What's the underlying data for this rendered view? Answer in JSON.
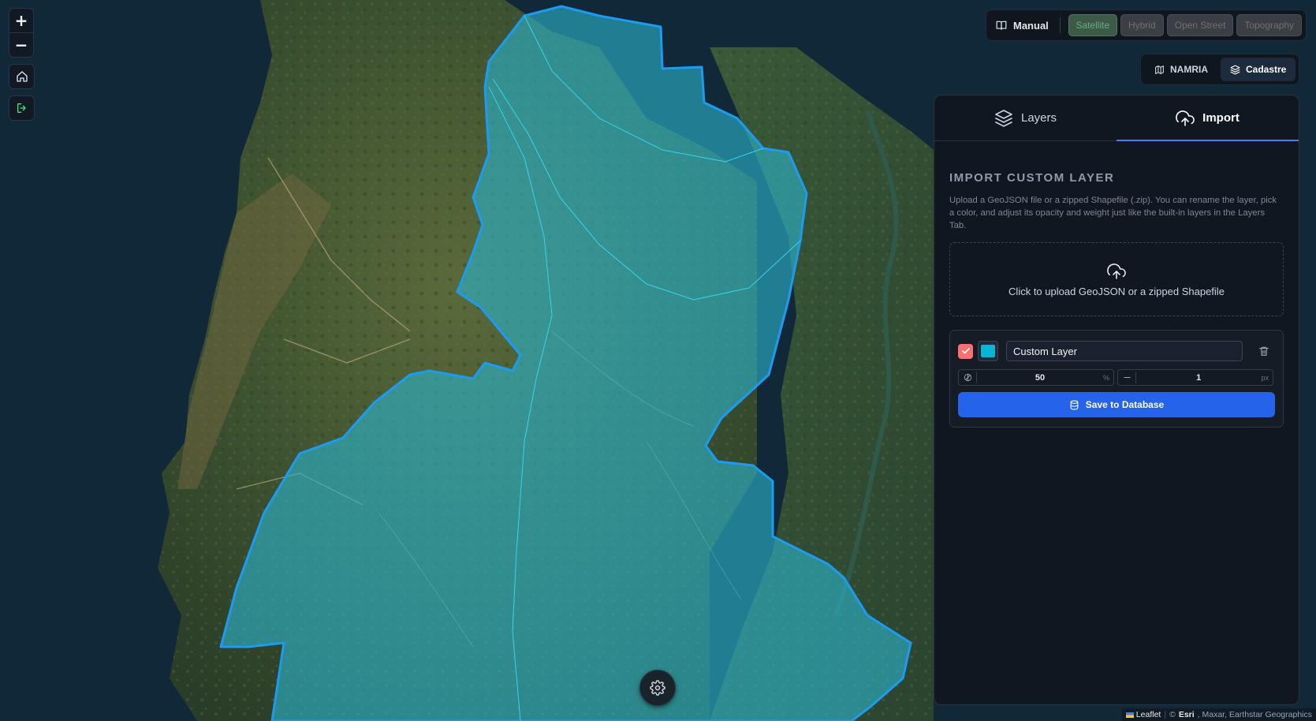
{
  "map": {
    "zoom_in_label": "+",
    "zoom_out_label": "−",
    "home_icon": "home-icon",
    "exit_icon": "log-out-icon",
    "overlay_color": "#2bb3c9",
    "border_color": "#1d9bf0"
  },
  "basemap": {
    "manual_label": "Manual",
    "options": [
      "Satellite",
      "Hybrid",
      "Open Street",
      "Topography"
    ],
    "active": "Satellite"
  },
  "source": {
    "options": [
      "NAMRIA",
      "Cadastre"
    ],
    "active": "Cadastre"
  },
  "panel": {
    "tabs": [
      {
        "label": "Layers",
        "icon": "layers-icon"
      },
      {
        "label": "Import",
        "icon": "cloud-upload-icon"
      }
    ],
    "active_tab": "Import",
    "title": "Import Custom Layer",
    "description": "Upload a GeoJSON file or a zipped Shapefile (.zip). You can rename the layer, pick a color, and adjust its opacity and weight just like the built-in layers in the Layers Tab.",
    "upload_text": "Click to upload GeoJSON or a zipped Shapefile",
    "layer": {
      "visible": true,
      "color": "#06b6d4",
      "name": "Custom Layer",
      "opacity": "50",
      "opacity_unit": "%",
      "weight": "1",
      "weight_unit": "px"
    },
    "save_label": "Save to Database"
  },
  "attribution": {
    "leaflet": "Leaflet",
    "copyright": "©",
    "esri": "Esri",
    "rest": ", Maxar, Earthstar Geographics"
  }
}
